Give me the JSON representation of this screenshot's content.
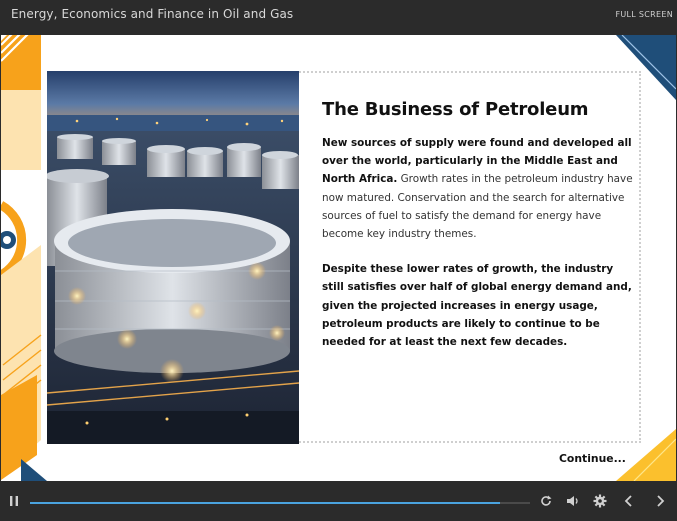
{
  "window": {
    "title": "Energy, Economics and Finance in Oil and Gas",
    "fullscreen_label": "FULL SCREEN"
  },
  "slide": {
    "heading": "The Business of Petroleum",
    "paragraph1_bold": "New sources of supply were found and developed all over the world, particularly in the Middle East and North Africa.",
    "paragraph1_rest": " Growth rates in the petroleum industry have now matured. Conservation and the search for alternative sources of fuel to satisfy the demand for energy have become key industry themes.",
    "paragraph2": "Despite these lower rates of growth, the industry still satisfies over half of global energy demand and, given the projected increases in energy usage, petroleum products are likely to continue to be needed for at least the next few decades.",
    "continue_label": "Continue..."
  },
  "player": {
    "progress": 0.94,
    "icons": [
      "pause-icon",
      "replay-icon",
      "volume-icon",
      "settings-icon",
      "previous-icon",
      "next-icon"
    ]
  },
  "colors": {
    "accent_orange": "#f7a21b",
    "accent_navy": "#1f4e79",
    "accent_yellow": "#fbc02d",
    "progress_blue": "#4aa3df"
  }
}
